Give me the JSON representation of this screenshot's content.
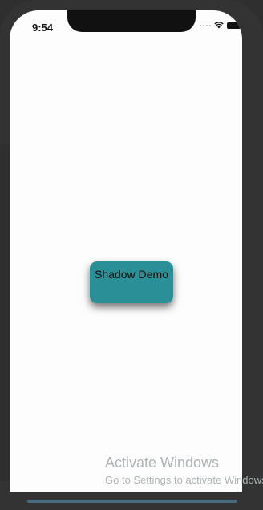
{
  "status_bar": {
    "time": "9:54"
  },
  "main": {
    "button_label": "Shadow Demo",
    "button_color": "#2a8f96"
  },
  "watermark": {
    "title": "Activate Windows",
    "subtitle": "Go to Settings to activate Windows."
  },
  "icons": {
    "signal": "signal-icon",
    "wifi": "wifi-icon",
    "battery": "battery-icon"
  }
}
